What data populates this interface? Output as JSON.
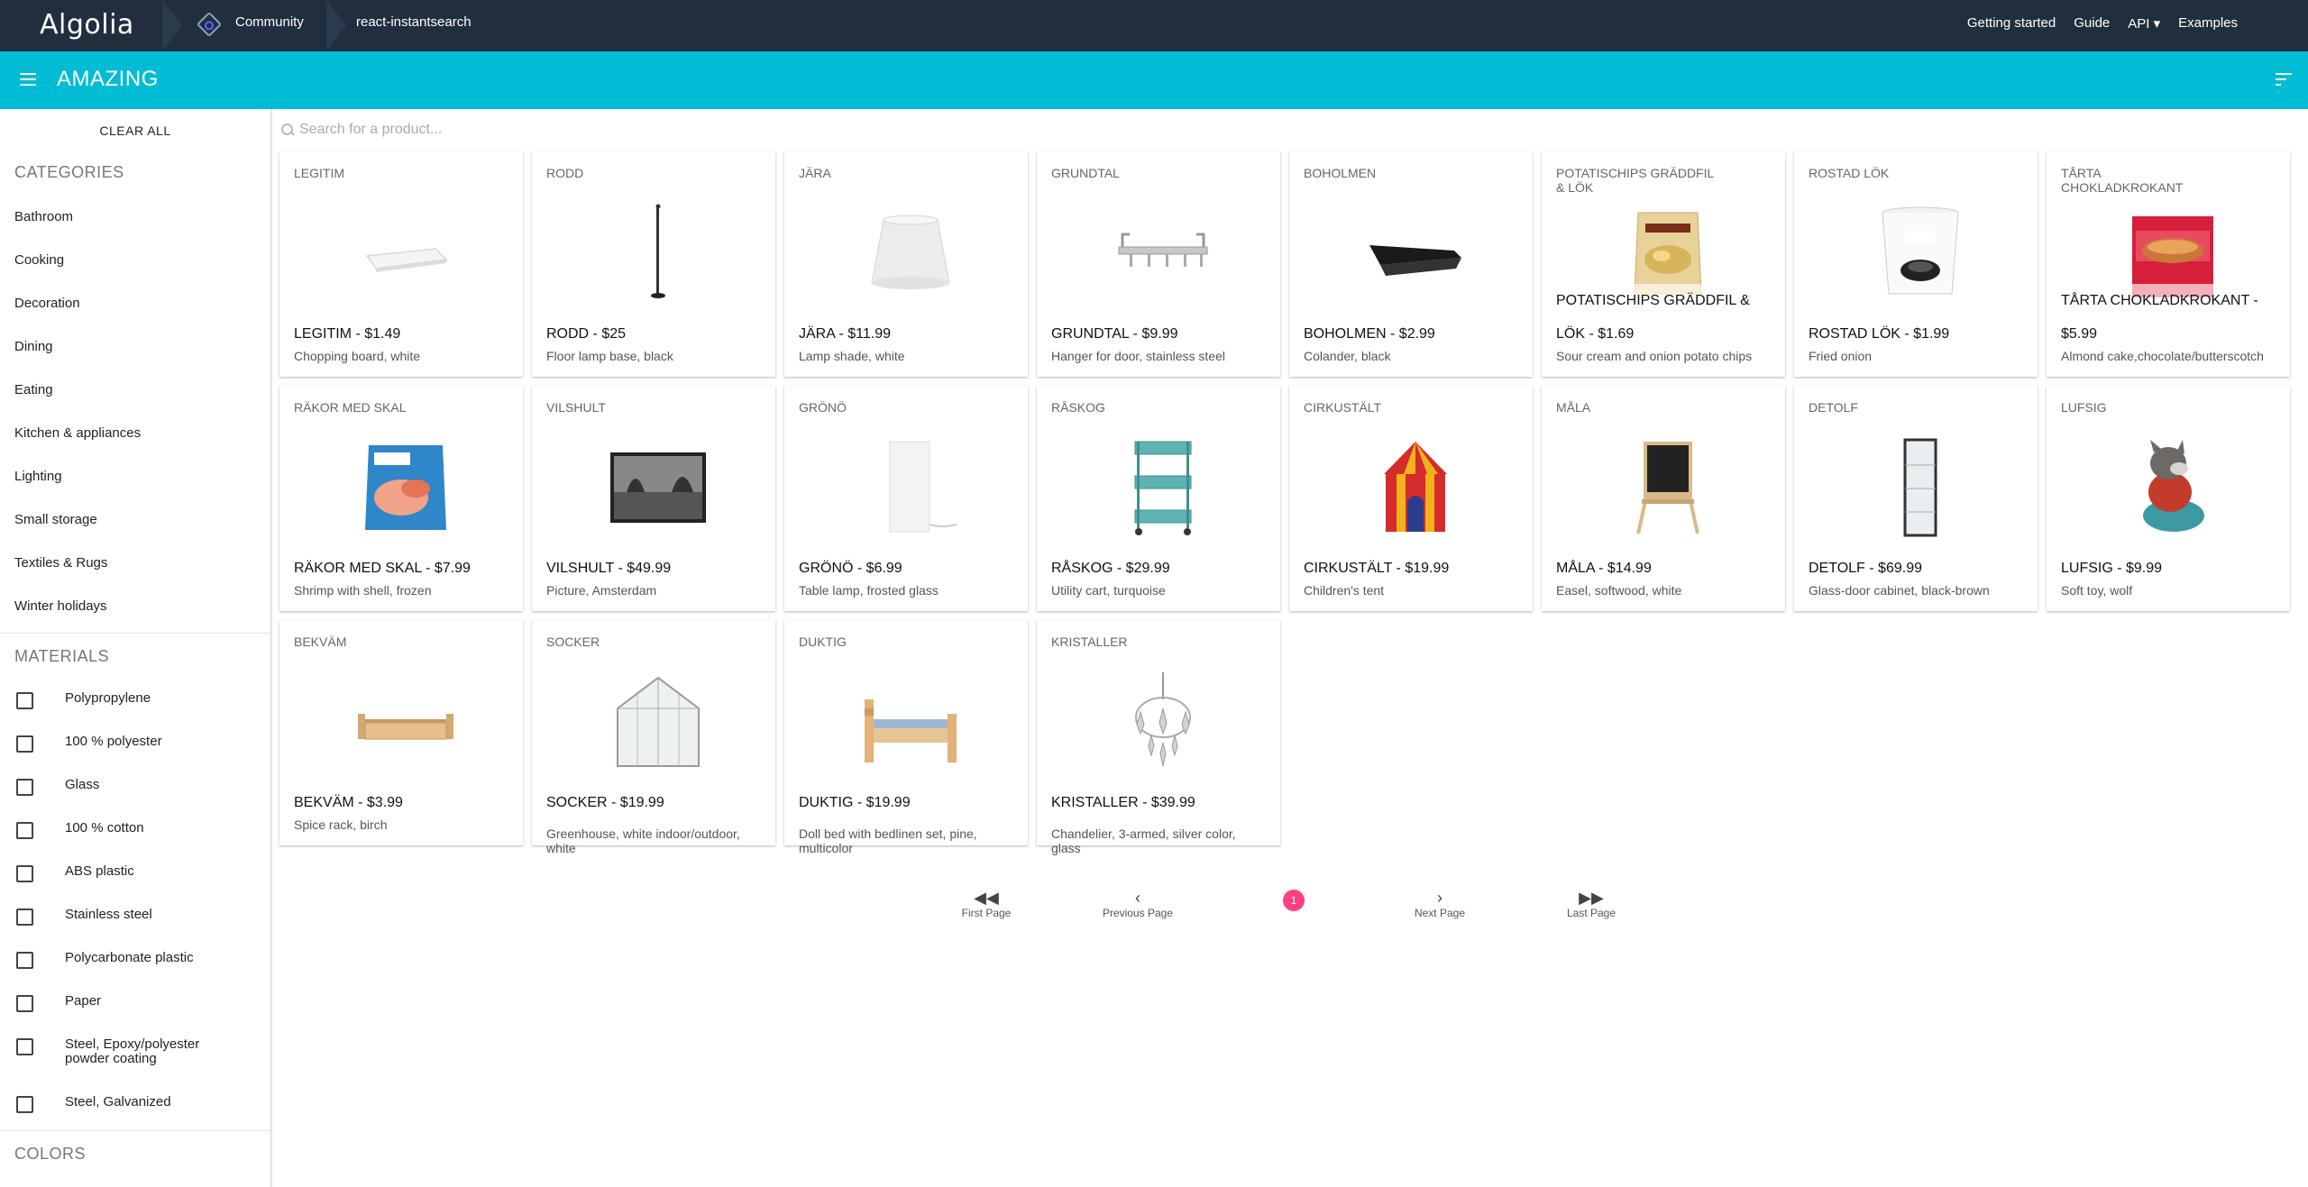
{
  "topnav": {
    "logo": "Algolia",
    "breadcrumb": [
      "Community",
      "react-instantsearch"
    ],
    "links": [
      "Getting started",
      "Guide",
      "API ▾",
      "Examples"
    ]
  },
  "appbar": {
    "title": "AMAZING"
  },
  "sidebar": {
    "clear_all": "CLEAR ALL",
    "categories_title": "CATEGORIES",
    "categories": [
      "Bathroom",
      "Cooking",
      "Decoration",
      "Dining",
      "Eating",
      "Kitchen & appliances",
      "Lighting",
      "Small storage",
      "Textiles & Rugs",
      "Winter holidays"
    ],
    "materials_title": "MATERIALS",
    "materials": [
      "Polypropylene",
      "100 % polyester",
      "Glass",
      "100 % cotton",
      "ABS plastic",
      "Stainless steel",
      "Polycarbonate plastic",
      "Paper",
      "Steel, Epoxy/polyester powder coating",
      "Steel, Galvanized"
    ],
    "colors_title": "COLORS"
  },
  "search": {
    "placeholder": "Search for a product..."
  },
  "products": [
    {
      "name": "LEGITIM",
      "price": "LEGITIM - $1.49",
      "desc": "Chopping board, white",
      "icon": "chopping-board"
    },
    {
      "name": "RODD",
      "price": "RODD - $25",
      "desc": "Floor lamp base, black",
      "icon": "floor-lamp"
    },
    {
      "name": "JÄRA",
      "price": "JÄRA - $11.99",
      "desc": "Lamp shade, white",
      "icon": "lamp-shade"
    },
    {
      "name": "GRUNDTAL",
      "price": "GRUNDTAL - $9.99",
      "desc": "Hanger for door, stainless steel",
      "icon": "door-hanger"
    },
    {
      "name": "BOHOLMEN",
      "price": "BOHOLMEN - $2.99",
      "desc": "Colander, black",
      "icon": "colander"
    },
    {
      "name": "POTATISCHIPS GRÄDDFIL & LÖK",
      "price": "POTATISCHIPS GRÄDDFIL & LÖK - $1.69",
      "desc": "Sour cream and onion potato chips",
      "icon": "chips-bag"
    },
    {
      "name": "ROSTAD LÖK",
      "price": "ROSTAD LÖK - $1.99",
      "desc": "Fried onion",
      "icon": "onion-tub"
    },
    {
      "name": "TÅRTA CHOKLADKROKANT",
      "price": "TÅRTA CHOKLADKROKANT - $5.99",
      "desc": "Almond cake,chocolate/butterscotch",
      "icon": "cake-box"
    },
    {
      "name": "RÄKOR MED SKAL",
      "price": "RÄKOR MED SKAL - $7.99",
      "desc": "Shrimp with shell, frozen",
      "icon": "shrimp-bag"
    },
    {
      "name": "VILSHULT",
      "price": "VILSHULT - $49.99",
      "desc": "Picture, Amsterdam",
      "icon": "picture-frame"
    },
    {
      "name": "GRÖNÖ",
      "price": "GRÖNÖ - $6.99",
      "desc": "Table lamp, frosted glass",
      "icon": "table-lamp"
    },
    {
      "name": "RÅSKOG",
      "price": "RÅSKOG - $29.99",
      "desc": "Utility cart, turquoise",
      "icon": "utility-cart"
    },
    {
      "name": "CIRKUSTÄLT",
      "price": "CIRKUSTÄLT - $19.99",
      "desc": "Children's tent",
      "icon": "circus-tent"
    },
    {
      "name": "MÅLA",
      "price": "MÅLA - $14.99",
      "desc": "Easel, softwood, white",
      "icon": "easel"
    },
    {
      "name": "DETOLF",
      "price": "DETOLF - $69.99",
      "desc": "Glass-door cabinet, black-brown",
      "icon": "glass-cabinet"
    },
    {
      "name": "LUFSIG",
      "price": "LUFSIG - $9.99",
      "desc": "Soft toy, wolf",
      "icon": "soft-toy-wolf"
    },
    {
      "name": "BEKVÄM",
      "price": "BEKVÄM - $3.99",
      "desc": "Spice rack, birch",
      "icon": "spice-rack"
    },
    {
      "name": "SOCKER",
      "price": "SOCKER - $19.99",
      "desc": "Greenhouse, white indoor/outdoor, white",
      "icon": "greenhouse"
    },
    {
      "name": "DUKTIG",
      "price": "DUKTIG - $19.99",
      "desc": "Doll bed with bedlinen set, pine, multicolor",
      "icon": "doll-bed"
    },
    {
      "name": "KRISTALLER",
      "price": "KRISTALLER - $39.99",
      "desc": "Chandelier, 3-armed, silver color, glass",
      "icon": "chandelier"
    }
  ],
  "pagination": {
    "first": "First Page",
    "previous": "Previous Page",
    "current": "1",
    "next": "Next Page",
    "last": "Last Page"
  },
  "colors": {
    "topnav": "#202e3e",
    "appbar": "#00bcd4",
    "accent": "#ff4081"
  }
}
